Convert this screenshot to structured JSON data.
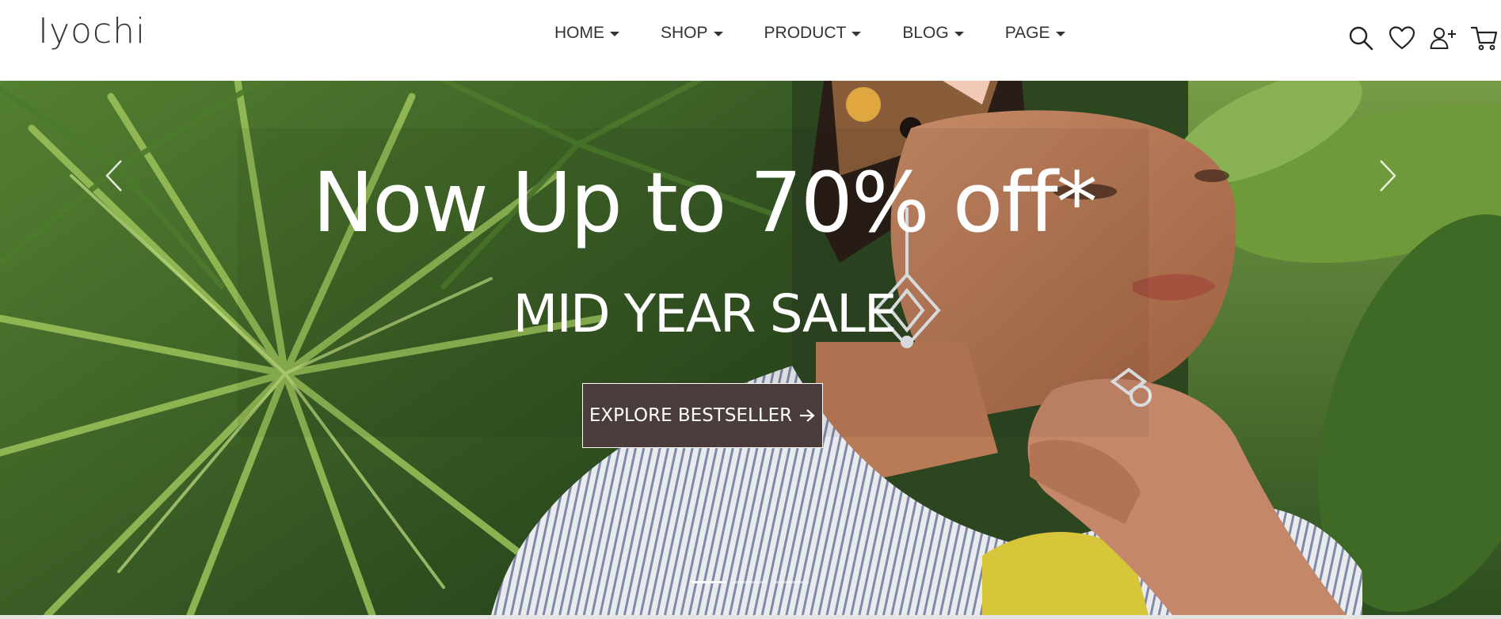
{
  "header": {
    "logo": "Iyochi",
    "nav": [
      {
        "label": "HOME"
      },
      {
        "label": "SHOP"
      },
      {
        "label": "PRODUCT"
      },
      {
        "label": "BLOG"
      },
      {
        "label": "PAGE"
      }
    ],
    "icons": [
      "search-icon",
      "heart-icon",
      "user-plus-icon",
      "cart-icon"
    ]
  },
  "hero": {
    "title": "Now Up to 70% off*",
    "subtitle": "MID YEAR SALE",
    "cta_label": "EXPLORE BESTSELLER",
    "slides": {
      "count": 3,
      "active": 0
    }
  },
  "colors": {
    "brand_dark": "#4a3d3b",
    "text": "#333333",
    "white": "#ffffff"
  }
}
